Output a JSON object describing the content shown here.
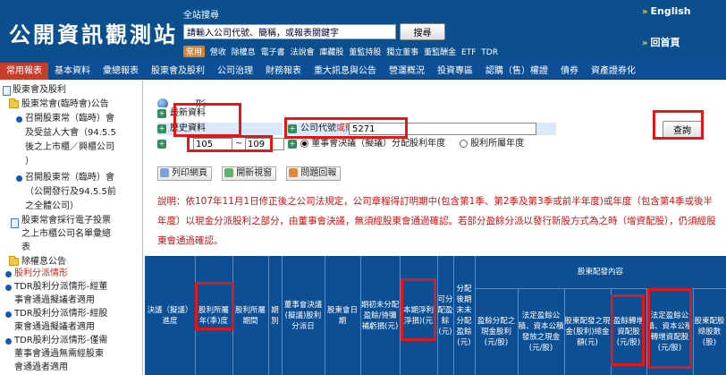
{
  "header": {
    "logo": "公開資訊觀測站",
    "search_label": "全站搜尋",
    "search_placeholder": "請輸入公司代號、簡稱，或報表關鍵字",
    "search_button": "搜尋",
    "common_badge": "常用",
    "quick_links": [
      "營收",
      "除權息",
      "電子書",
      "法說會",
      "庫藏股",
      "董監持股",
      "獨立董事",
      "董監酬金",
      "ETF",
      "TDR"
    ],
    "english_link": "English",
    "home_link": "回首頁"
  },
  "nav": [
    "常用報表",
    "基本資料",
    "彙總報表",
    "股東會及股利",
    "公司治理",
    "財務報表",
    "重大訊息與公告",
    "營運概況",
    "投資專區",
    "認購（售）權證",
    "債券",
    "資產證券化"
  ],
  "sidebar": {
    "items": [
      "股東會及股利",
      "股東常會(臨時會)公告",
      "召開股東常（臨時）會",
      "及受益人大會（94.5.5",
      "後之上市櫃／興櫃公司",
      "）",
      "召開股東常（臨時）會",
      "（公開發行及94.5.5前",
      "之全體公司）",
      "股東常會採行電子投票",
      "之上市櫃公司名單彙總",
      "表",
      "除權息公告",
      "股利分派情形",
      "TDR股利分派情形-經董",
      "事會通過擬議者適用",
      "TDR股利分派情形-經股",
      "東會通過擬議者適用",
      "TDR股利分派情形-僅需",
      "董事會通過無需經股東",
      "會通過者適用"
    ]
  },
  "main": {
    "page_title": "形",
    "latest_label": "最新資料",
    "history_label": "歷史資料",
    "year_from": "105",
    "year_to": "109",
    "company_label_prefix": "公司代號",
    "company_label_red": "或簡稱",
    "company_value": "5271",
    "radio_board": "董事會決議（擬議）分配股利年度",
    "radio_period": "股利所屬年度",
    "query_button": "查詢",
    "toolbar": [
      "列印網頁",
      "開新視窗",
      "問題回報"
    ],
    "notice": "說明：依107年11月1日修正後之公司法規定，公司章程得訂明期中(包含第1季、第2季及第3季或前半年度)或年度（包含第4季或後半年度）以現金分派股利之部分，由董事會決議，無須經股東會通過確認。若部分盈餘分派以發行新股方式為之時（增資配股），仍須經股東會通過確認。"
  },
  "table": {
    "headers": [
      "決議（擬議）進度",
      "股利所屬年(季)度",
      "股利所屬期間",
      "期別",
      "董事會決議(擬議)股利分派日",
      "股東會日期",
      "期初未分配盈餘/待彌補虧損(元)",
      "本期淨利(淨損)(元)",
      "可分配盈餘(元)",
      "分配後期末未分配盈餘(元)",
      "股東配發內容",
      "盈餘分配之現金股利(元/股)",
      "法定盈餘公積、資本公積發放之現金(元/股)",
      "股東配發之現金(股利)總金額(元)",
      "盈餘轉增資配股(元/股)",
      "法定盈餘公積、資本公積轉增資配股(元/股)",
      "股東配股總股數(股)"
    ]
  }
}
